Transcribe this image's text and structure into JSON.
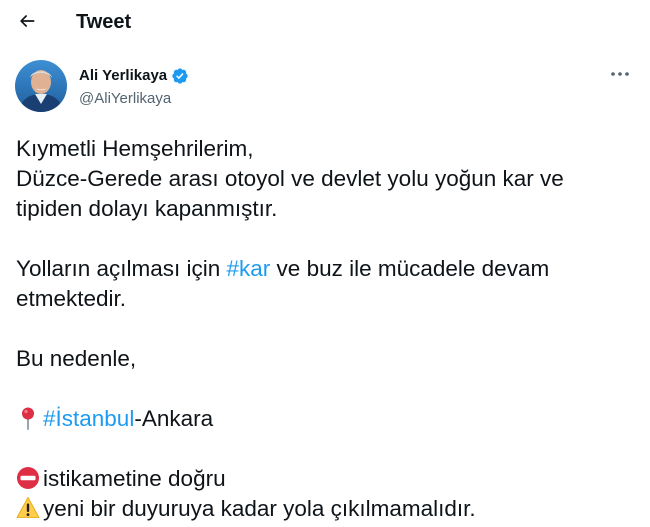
{
  "header": {
    "back_icon": "arrow-left-icon",
    "title": "Tweet"
  },
  "author": {
    "name": "Ali Yerlikaya",
    "handle": "@AliYerlikaya",
    "verified_icon": "verified-badge-icon",
    "more_icon": "more-horizontal-icon"
  },
  "tweet": {
    "line1": "Kıymetli Hemşehrilerim,",
    "line2": "Düzce-Gerede arası otoyol ve devlet yolu yoğun kar ve",
    "line3": "tipiden dolayı kapanmıştır.",
    "line5_before": "Yolların açılması için ",
    "line5_hashtag": "#kar",
    "line5_after": " ve buz ile mücadele devam",
    "line6": "etmektedir.",
    "line8": "Bu nedenle,",
    "line10_hashtag": "#İstanbul",
    "line10_after": "-Ankara",
    "line12": "istikametine doğru",
    "line13": "yeni bir duyuruya kadar yola çıkılmamalıdır.",
    "icons": [
      "round-pushpin-icon",
      "no-entry-icon",
      "warning-icon"
    ]
  },
  "colors": {
    "accent": "#1d9bf0",
    "text": "#0f1419",
    "secondary": "#536471"
  }
}
